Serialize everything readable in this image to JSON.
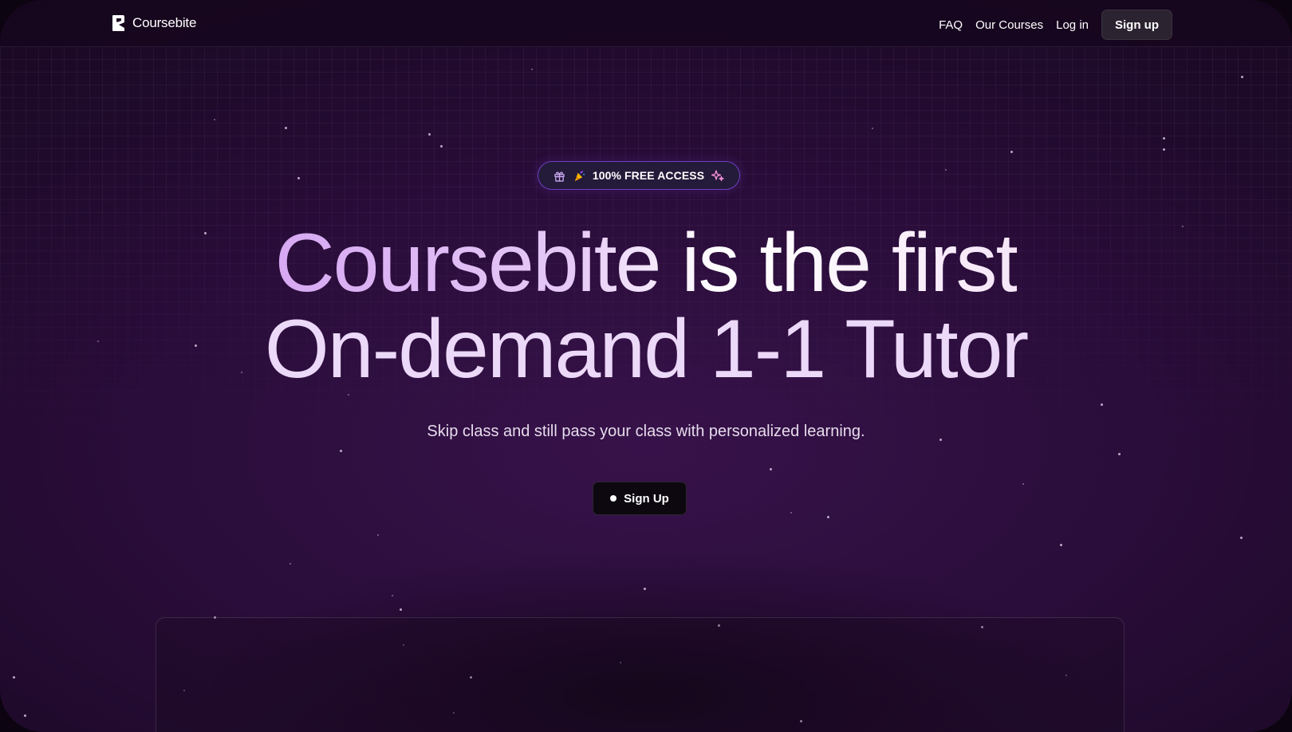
{
  "nav": {
    "brand_name": "Coursebite",
    "links": [
      "FAQ",
      "Our Courses",
      "Log in"
    ],
    "signup_label": "Sign up"
  },
  "hero": {
    "badge_text": "100% FREE ACCESS",
    "headline_line1": "Coursebite is the first",
    "headline_line2": "On-demand 1-1 Tutor",
    "subtitle": "Skip class and still pass your class with personalized learning.",
    "cta_label": "Sign Up"
  },
  "icons": {
    "brand": "coursebite-logo-icon",
    "badge_left": "gift-icon",
    "badge_party": "party-popper-icon",
    "badge_right": "sparkles-icon",
    "cta": "dot-icon"
  },
  "colors": {
    "background": "#2a0d3a",
    "headline_gradient_start": "#d6a8f2",
    "badge_border": "#6c3fc0",
    "cta_background": "#0d0810",
    "nav_signup_background": "#2b2330"
  }
}
